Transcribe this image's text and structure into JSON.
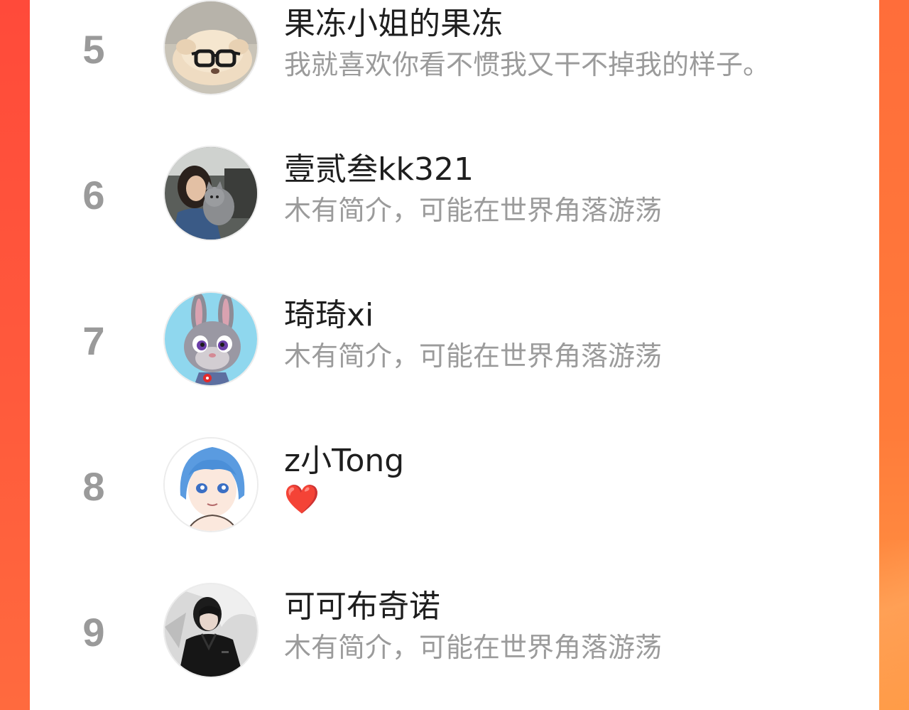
{
  "ranking": [
    {
      "rank": "5",
      "name": "果冻小姐的果冻",
      "bio": "我就喜欢你看不惯我又干不掉我的样子。",
      "avatar_icon": "puppy-with-glasses"
    },
    {
      "rank": "6",
      "name": "壹贰叁kk321",
      "bio": "木有简介，可能在世界角落游荡",
      "avatar_icon": "girl-holding-cat-photo"
    },
    {
      "rank": "7",
      "name": "琦琦xi",
      "bio": "木有简介，可能在世界角落游荡",
      "avatar_icon": "cartoon-bunny"
    },
    {
      "rank": "8",
      "name": "z小Tong",
      "bio": "❤️",
      "avatar_icon": "anime-girl-blue-hair"
    },
    {
      "rank": "9",
      "name": "可可布奇诺",
      "bio": "木有简介，可能在世界角落游荡",
      "avatar_icon": "man-in-black-jacket"
    }
  ],
  "colors": {
    "left_gradient": "#ff4a3a",
    "right_gradient": "#ff7b3a",
    "rank_number": "#9a9a9a",
    "name_text": "#1e1e1e",
    "bio_text": "#9b9b9b"
  }
}
